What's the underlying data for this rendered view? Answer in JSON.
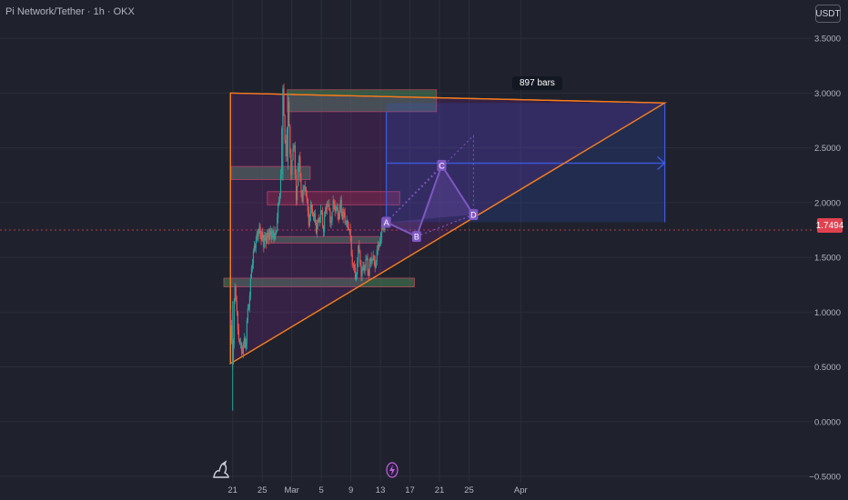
{
  "header": {
    "title": "Pi Network/Tether · 1h · OKX"
  },
  "currency_button": {
    "label": "USDT"
  },
  "last_price": {
    "value": "1.7494",
    "color": "#e0414f"
  },
  "range_label": {
    "text": "897 bars"
  },
  "colors": {
    "up": "#26a69a",
    "down": "#ef5350",
    "triangle": "#f57c1f",
    "projection": "#3d57d8",
    "pattern": "#7e57c2"
  },
  "chart_data": {
    "type": "candlestick",
    "symbol": "Pi Network/Tether",
    "interval": "1h",
    "exchange": "OKX",
    "y_axis": {
      "ticks": [
        -0.5,
        0.0,
        0.5,
        1.0,
        1.5,
        2.0,
        2.5,
        3.0,
        3.5
      ],
      "tick_labels": [
        "−0.5000",
        "0.0000",
        "0.5000",
        "1.0000",
        "1.5000",
        "2.0000",
        "2.5000",
        "3.0000",
        "3.5000"
      ],
      "ylim": [
        -0.55,
        3.85
      ]
    },
    "x_axis": {
      "labels": [
        "21",
        "25",
        "Mar",
        "5",
        "9",
        "13",
        "17",
        "21",
        "25",
        "Apr"
      ],
      "days": [
        0,
        4,
        8,
        12,
        16,
        20,
        24,
        28,
        32,
        39
      ],
      "xlim": [
        -31.5,
        78.5
      ]
    },
    "price_path": [
      [
        -0.4,
        1.0
      ],
      [
        0.0,
        0.5
      ],
      [
        0.3,
        1.3
      ],
      [
        0.7,
        0.8
      ],
      [
        1.2,
        0.65
      ],
      [
        1.8,
        0.75
      ],
      [
        2.3,
        1.2
      ],
      [
        2.8,
        1.55
      ],
      [
        3.5,
        1.75
      ],
      [
        4.2,
        1.65
      ],
      [
        5.0,
        1.72
      ],
      [
        5.8,
        1.7
      ],
      [
        6.5,
        2.2
      ],
      [
        6.8,
        3.0
      ],
      [
        7.2,
        2.4
      ],
      [
        7.5,
        2.9
      ],
      [
        7.9,
        2.3
      ],
      [
        8.3,
        2.5
      ],
      [
        8.6,
        2.1
      ],
      [
        9.0,
        2.4
      ],
      [
        9.4,
        2.0
      ],
      [
        9.8,
        2.15
      ],
      [
        10.3,
        1.85
      ],
      [
        10.8,
        1.95
      ],
      [
        11.3,
        1.75
      ],
      [
        11.8,
        1.9
      ],
      [
        12.3,
        1.8
      ],
      [
        12.8,
        2.0
      ],
      [
        13.2,
        1.85
      ],
      [
        13.6,
        2.0
      ],
      [
        14.1,
        1.9
      ],
      [
        14.6,
        1.95
      ],
      [
        15.2,
        1.85
      ],
      [
        15.7,
        1.78
      ],
      [
        16.2,
        1.5
      ],
      [
        16.6,
        1.3
      ],
      [
        17.0,
        1.55
      ],
      [
        17.4,
        1.35
      ],
      [
        17.9,
        1.45
      ],
      [
        18.4,
        1.4
      ],
      [
        18.9,
        1.5
      ],
      [
        19.4,
        1.45
      ],
      [
        19.8,
        1.6
      ],
      [
        20.2,
        1.75
      ],
      [
        20.6,
        1.82
      ]
    ],
    "wick_spikes": [
      {
        "day": 0.0,
        "high": 1.1,
        "low": 0.1
      },
      {
        "day": 6.8,
        "high": 3.0,
        "low": 2.2
      },
      {
        "day": 7.5,
        "high": 3.0,
        "low": 2.3
      }
    ],
    "zones": [
      {
        "d1": 7.4,
        "d2": 27.6,
        "p1": 2.83,
        "p2": 3.03,
        "color": "green"
      },
      {
        "d1": -0.2,
        "d2": 10.5,
        "p1": 2.21,
        "p2": 2.33,
        "color": "green"
      },
      {
        "d1": 4.7,
        "d2": 22.6,
        "p1": 1.98,
        "p2": 2.1,
        "color": "red"
      },
      {
        "d1": 4.6,
        "d2": 20.2,
        "p1": 1.63,
        "p2": 1.69,
        "color": "green"
      },
      {
        "d1": -1.2,
        "d2": 24.6,
        "p1": 1.23,
        "p2": 1.31,
        "color": "green"
      }
    ],
    "triangle": [
      [
        -0.3,
        3.0
      ],
      [
        58.5,
        2.91
      ],
      [
        -0.3,
        0.53
      ]
    ],
    "projection_box": {
      "d1": 20.8,
      "d2": 58.5,
      "p1": 1.82,
      "p2": 2.91,
      "target": 2.36
    },
    "harmonic_pattern": {
      "labels": [
        "A",
        "B",
        "C",
        "D"
      ],
      "points": [
        [
          20.8,
          1.82
        ],
        [
          24.9,
          1.69
        ],
        [
          28.3,
          2.34
        ],
        [
          32.6,
          1.89
        ]
      ]
    }
  }
}
